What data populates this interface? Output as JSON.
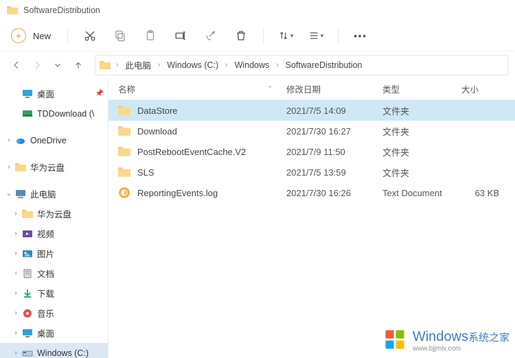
{
  "window": {
    "title": "SoftwareDistribution"
  },
  "toolbar": {
    "new_label": "New",
    "icons": {
      "cut": "cut-icon",
      "copy": "copy-icon",
      "paste": "paste-icon",
      "rename": "rename-icon",
      "share": "share-icon",
      "delete": "delete-icon",
      "sort": "sort-icon",
      "view": "view-icon",
      "more": "more-icon"
    }
  },
  "breadcrumb": {
    "items": [
      "此电脑",
      "Windows (C:)",
      "Windows",
      "SoftwareDistribution"
    ]
  },
  "columns": {
    "name": "名称",
    "date": "修改日期",
    "type": "类型",
    "size": "大小"
  },
  "tree": {
    "quick": [
      {
        "label": "桌面",
        "icon": "desktop",
        "pinned": true,
        "expander": ""
      },
      {
        "label": "TDDownload (\\",
        "icon": "netfolder",
        "pinned": false,
        "expander": ""
      }
    ],
    "onedrive": {
      "label": "OneDrive",
      "icon": "onedrive",
      "expander": ">"
    },
    "huawei": {
      "label": "华为云盘",
      "icon": "folder",
      "expander": ">"
    },
    "thispc": {
      "label": "此电脑",
      "icon": "pc",
      "expander": "v"
    },
    "pc_children": [
      {
        "label": "华为云盘",
        "icon": "folder",
        "expander": ">"
      },
      {
        "label": "视频",
        "icon": "videos",
        "expander": ">"
      },
      {
        "label": "图片",
        "icon": "pictures",
        "expander": ">"
      },
      {
        "label": "文档",
        "icon": "documents",
        "expander": ">"
      },
      {
        "label": "下载",
        "icon": "downloads",
        "expander": ">"
      },
      {
        "label": "音乐",
        "icon": "music",
        "expander": ">"
      },
      {
        "label": "桌面",
        "icon": "desktop",
        "expander": ">"
      },
      {
        "label": "Windows (C:)",
        "icon": "drive",
        "expander": ">",
        "selected": true
      }
    ]
  },
  "files": [
    {
      "name": "DataStore",
      "date": "2021/7/5 14:09",
      "type": "文件夹",
      "size": "",
      "icon": "folder",
      "selected": true
    },
    {
      "name": "Download",
      "date": "2021/7/30 16:27",
      "type": "文件夹",
      "size": "",
      "icon": "folder",
      "selected": false
    },
    {
      "name": "PostRebootEventCache.V2",
      "date": "2021/7/9 11:50",
      "type": "文件夹",
      "size": "",
      "icon": "folder",
      "selected": false
    },
    {
      "name": "SLS",
      "date": "2021/7/5 13:59",
      "type": "文件夹",
      "size": "",
      "icon": "folder",
      "selected": false
    },
    {
      "name": "ReportingEvents.log",
      "date": "2021/7/30 16:26",
      "type": "Text Document",
      "size": "63 KB",
      "icon": "logfile",
      "selected": false
    }
  ],
  "watermark": {
    "brand": "Windows",
    "suffix": "系统之家",
    "url": "www.bjjmlv.com"
  }
}
